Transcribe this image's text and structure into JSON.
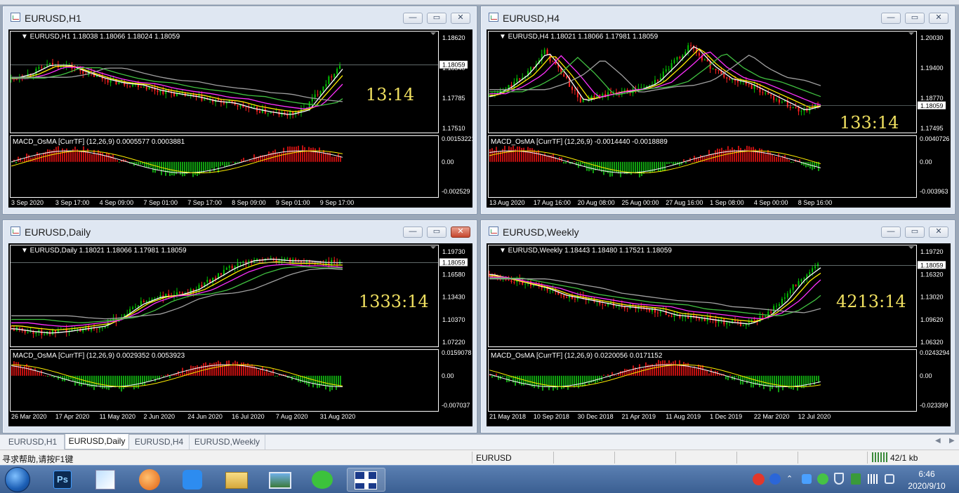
{
  "colors": {
    "candle_up": "#00c000",
    "candle_down": "#ff2020",
    "ma_white": "#ffffff",
    "ma_yellow": "#ffee00",
    "ma_magenta": "#ff30ff",
    "ma_green": "#40c040",
    "ma_gray": "#a0a0a0",
    "bar_red": "#c01010",
    "bar_green": "#10a010",
    "clock": "#f0e060"
  },
  "windows": [
    {
      "title": "EURUSD,H1",
      "info": "EURUSD,H1  1.18038 1.18066 1.18024 1.18059",
      "prices": [
        "1.18620",
        "1.18340",
        "1.18059",
        "1.17785",
        "1.17510"
      ],
      "current": "1.18059",
      "clock": "13:14",
      "macd": "MACD_OsMA [CurrTF] (12,26,9) 0.0005577 0.0003881",
      "macd_scale": [
        "0.00153221",
        "0.00",
        "-0.002529"
      ],
      "dates": [
        "3 Sep 2020",
        "3 Sep 17:00",
        "4 Sep 09:00",
        "7 Sep 01:00",
        "7 Sep 17:00",
        "8 Sep 09:00",
        "9 Sep 01:00",
        "9 Sep 17:00"
      ]
    },
    {
      "title": "EURUSD,H4",
      "info": "EURUSD,H4  1.18021 1.18066 1.17981 1.18059",
      "prices": [
        "1.20030",
        "1.19400",
        "1.18770",
        "1.18059",
        "1.17495"
      ],
      "current": "1.18059",
      "clock": "133:14",
      "macd": "MACD_OsMA [CurrTF] (12,26,9) -0.0014440 -0.0018889",
      "macd_scale": [
        "0.0040726",
        "0.00",
        "-0.003963"
      ],
      "dates": [
        "13 Aug 2020",
        "17 Aug 16:00",
        "20 Aug 08:00",
        "25 Aug 00:00",
        "27 Aug 16:00",
        "1 Sep 08:00",
        "4 Sep 00:00",
        "8 Sep 16:00"
      ]
    },
    {
      "title": "EURUSD,Daily",
      "info": "EURUSD,Daily  1.18021 1.18066 1.17981 1.18059",
      "prices": [
        "1.19730",
        "1.18059",
        "1.16580",
        "1.13430",
        "1.10370",
        "1.07220"
      ],
      "current": "1.18059",
      "clock": "1333:14",
      "macd": "MACD_OsMA [CurrTF] (12,26,9) 0.0029352 0.0053923",
      "macd_scale": [
        "0.0159078",
        "0.00",
        "-0.007037"
      ],
      "dates": [
        "26 Mar 2020",
        "17 Apr 2020",
        "11 May 2020",
        "2 Jun 2020",
        "24 Jun 2020",
        "16 Jul 2020",
        "7 Aug 2020",
        "31 Aug 2020"
      ]
    },
    {
      "title": "EURUSD,Weekly",
      "info": "EURUSD,Weekly  1.18443 1.18480 1.17521 1.18059",
      "prices": [
        "1.19720",
        "1.18059",
        "1.16320",
        "1.13020",
        "1.09620",
        "1.06320"
      ],
      "current": "1.18059",
      "clock": "4213:14",
      "macd": "MACD_OsMA [CurrTF] (12,26,9) 0.0220056 0.0171152",
      "macd_scale": [
        "0.0243294",
        "0.00",
        "-0.023399"
      ],
      "dates": [
        "21 May 2018",
        "10 Sep 2018",
        "30 Dec 2018",
        "21 Apr 2019",
        "11 Aug 2019",
        "1 Dec 2019",
        "22 Mar 2020",
        "12 Jul 2020"
      ]
    }
  ],
  "tabs": [
    "EURUSD,H1",
    "EURUSD,Daily",
    "EURUSD,H4",
    "EURUSD,Weekly"
  ],
  "status": {
    "help": "寻求帮助,请按F1键",
    "symbol": "EURUSD",
    "traffic": "42/1 kb"
  },
  "clock": {
    "time": "6:46",
    "date": "2020/9/10"
  }
}
